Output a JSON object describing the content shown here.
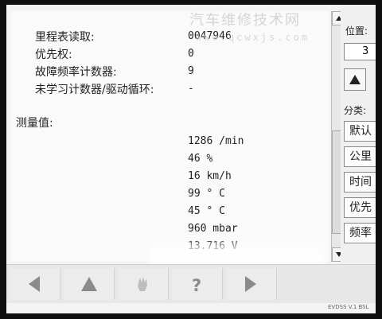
{
  "watermark": {
    "title": "汽车维修技术网",
    "url": "www.qcwxjs.com"
  },
  "fields": [
    {
      "label": "里程表读取:",
      "value": "0047946"
    },
    {
      "label": "优先权:",
      "value": "0"
    },
    {
      "label": "故障频率计数器:",
      "value": "9"
    },
    {
      "label": "未学习计数器/驱动循环:",
      "value": "-"
    }
  ],
  "measurements": {
    "heading": "测量值:",
    "values": [
      "1286 /min",
      "46 %",
      "16 km/h",
      "99 ° C",
      "45 ° C",
      "960 mbar",
      "13.716 V"
    ]
  },
  "sidebar": {
    "position_label": "位置:",
    "position_value": "3",
    "category_label": "分类:",
    "buttons": [
      "默认",
      "公里",
      "时间",
      "优先",
      "频率"
    ]
  },
  "statusbar": {
    "text": "EVDSS V.1 BSL"
  }
}
